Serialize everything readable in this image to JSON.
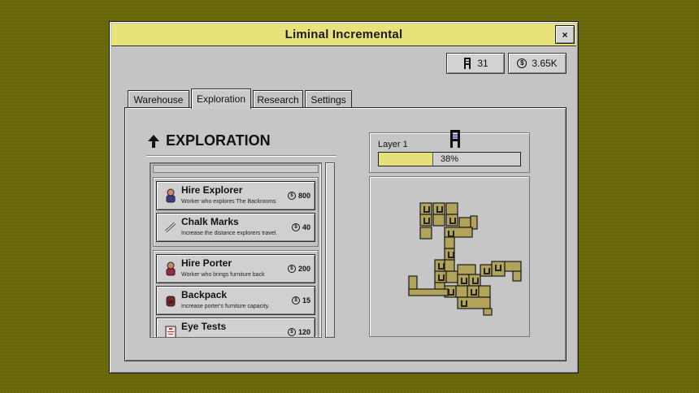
{
  "window": {
    "title": "Liminal Incremental",
    "close_label": "×"
  },
  "resources": {
    "chairs": {
      "icon": "chair-icon",
      "value": "31"
    },
    "money": {
      "icon": "coin-icon",
      "value": "3.65K"
    }
  },
  "tabs": [
    {
      "label": "Warehouse",
      "active": false
    },
    {
      "label": "Exploration",
      "active": true
    },
    {
      "label": "Research",
      "active": false
    },
    {
      "label": "Settings",
      "active": false
    }
  ],
  "exploration": {
    "heading_icon": "arrow-up-icon",
    "heading": "EXPLORATION",
    "groups": [
      {
        "items": [
          {
            "title": "Hire Explorer",
            "desc": "Worker who explores The Backrooms",
            "cost": "800",
            "icon": "explorer-icon"
          },
          {
            "title": "Chalk Marks",
            "desc": "Increase the distance explorers travel.",
            "cost": "40",
            "icon": "chalk-icon"
          }
        ]
      },
      {
        "items": [
          {
            "title": "Hire Porter",
            "desc": "Worker who brings furniture back",
            "cost": "200",
            "icon": "porter-icon"
          },
          {
            "title": "Backpack",
            "desc": "Increase porter's furniture capacity.",
            "cost": "15",
            "icon": "backpack-icon"
          },
          {
            "title": "Eye Tests",
            "desc": "",
            "cost": "120",
            "icon": "eye-chart-icon"
          }
        ]
      }
    ]
  },
  "layer": {
    "label": "Layer 1",
    "progress_text": "38%",
    "progress": 0.38,
    "icon": "chair-icon"
  },
  "colors": {
    "accent": "#e8e27a",
    "background": "#6b6b0c",
    "panel": "#c4c4c4",
    "map_room": "#b2a35a"
  }
}
